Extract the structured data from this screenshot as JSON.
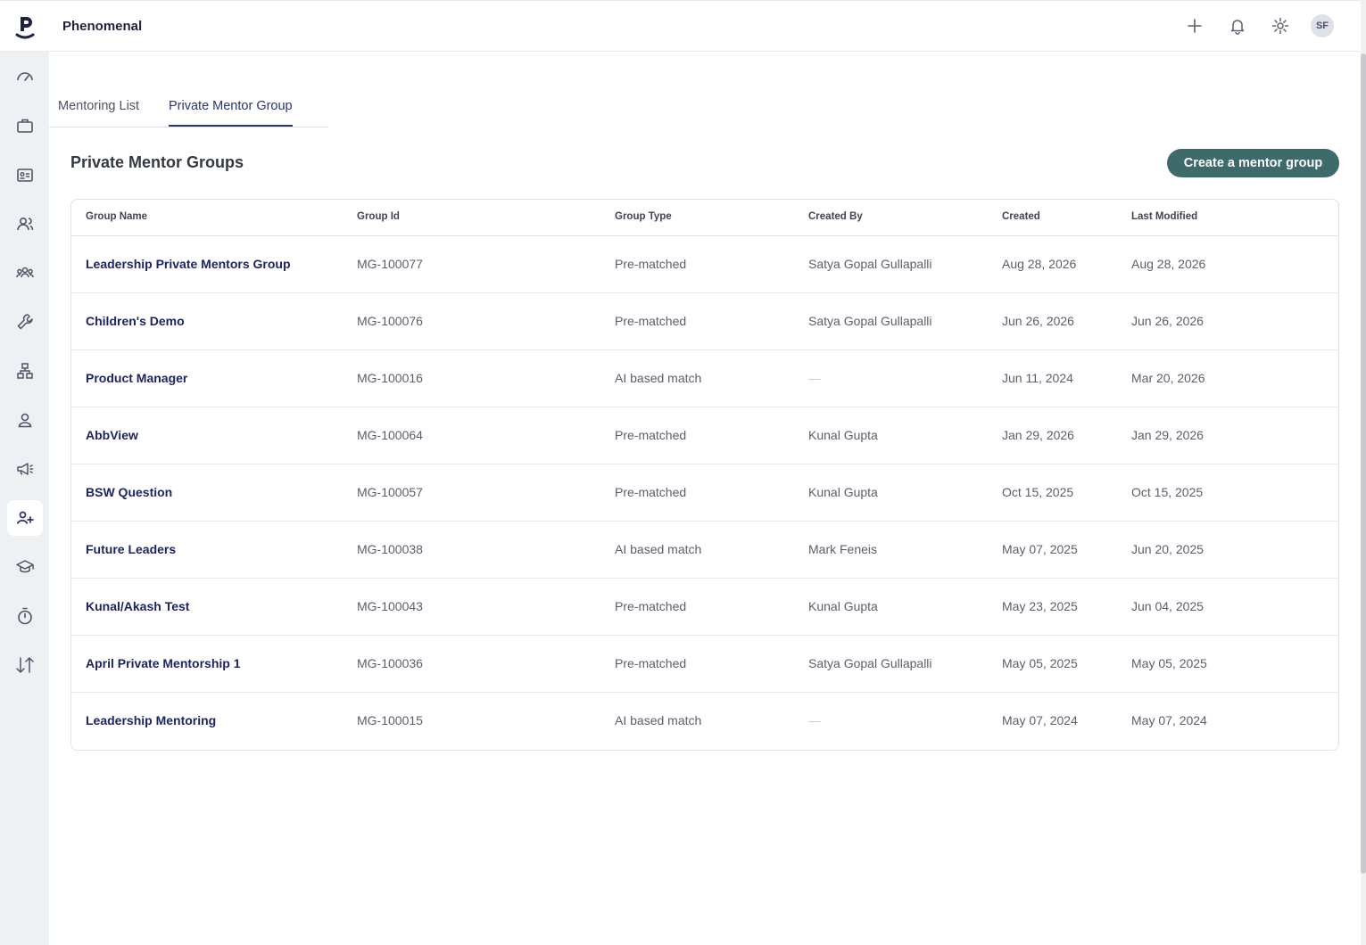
{
  "app": {
    "name": "Phenomenal",
    "avatar_initials": "SF"
  },
  "header_icons": [
    "plus-icon",
    "bell-icon",
    "gear-icon"
  ],
  "sidebar": {
    "items": [
      {
        "icon": "dashboard-icon"
      },
      {
        "icon": "briefcase-icon"
      },
      {
        "icon": "id-card-icon"
      },
      {
        "icon": "users-icon"
      },
      {
        "icon": "team-icon"
      },
      {
        "icon": "wrench-icon"
      },
      {
        "icon": "org-chart-icon"
      },
      {
        "icon": "person-icon"
      },
      {
        "icon": "megaphone-icon"
      },
      {
        "icon": "mentoring-icon",
        "active": true
      },
      {
        "icon": "graduation-cap-icon"
      },
      {
        "icon": "stopwatch-icon"
      },
      {
        "icon": "sort-arrows-icon"
      }
    ]
  },
  "tabs": [
    {
      "label": "Mentoring List"
    },
    {
      "label": "Private Mentor Group",
      "active": true
    }
  ],
  "page": {
    "title": "Private Mentor Groups",
    "create_button": "Create a mentor group"
  },
  "table": {
    "columns": [
      "Group Name",
      "Group Id",
      "Group Type",
      "Created By",
      "Created",
      "Last Modified"
    ],
    "rows": [
      {
        "name": "Leadership Private Mentors Group",
        "id": "MG-100077",
        "type": "Pre-matched",
        "created_by": "Satya Gopal Gullapalli",
        "created": "Aug 28, 2026",
        "modified": "Aug 28, 2026"
      },
      {
        "name": "Children's Demo",
        "id": "MG-100076",
        "type": "Pre-matched",
        "created_by": "Satya Gopal Gullapalli",
        "created": "Jun 26, 2026",
        "modified": "Jun 26, 2026"
      },
      {
        "name": "Product Manager",
        "id": "MG-100016",
        "type": "AI based match",
        "created_by": "—",
        "created": "Jun 11, 2024",
        "modified": "Mar 20, 2026"
      },
      {
        "name": "AbbView",
        "id": "MG-100064",
        "type": "Pre-matched",
        "created_by": "Kunal Gupta",
        "created": "Jan 29, 2026",
        "modified": "Jan 29, 2026"
      },
      {
        "name": "BSW Question",
        "id": "MG-100057",
        "type": "Pre-matched",
        "created_by": "Kunal Gupta",
        "created": "Oct 15, 2025",
        "modified": "Oct 15, 2025"
      },
      {
        "name": "Future Leaders",
        "id": "MG-100038",
        "type": "AI based match",
        "created_by": "Mark Feneis",
        "created": "May 07, 2025",
        "modified": "Jun 20, 2025"
      },
      {
        "name": "Kunal/Akash Test",
        "id": "MG-100043",
        "type": "Pre-matched",
        "created_by": "Kunal Gupta",
        "created": "May 23, 2025",
        "modified": "Jun 04, 2025"
      },
      {
        "name": "April Private Mentorship 1",
        "id": "MG-100036",
        "type": "Pre-matched",
        "created_by": "Satya Gopal Gullapalli",
        "created": "May 05, 2025",
        "modified": "May 05, 2025"
      },
      {
        "name": "Leadership Mentoring",
        "id": "MG-100015",
        "type": "AI based match",
        "created_by": "—",
        "created": "May 07, 2024",
        "modified": "May 07, 2024"
      }
    ]
  },
  "colors": {
    "accent": "#2a3470",
    "button": "#3e6b69",
    "sidebar_bg": "#eef1f4"
  }
}
